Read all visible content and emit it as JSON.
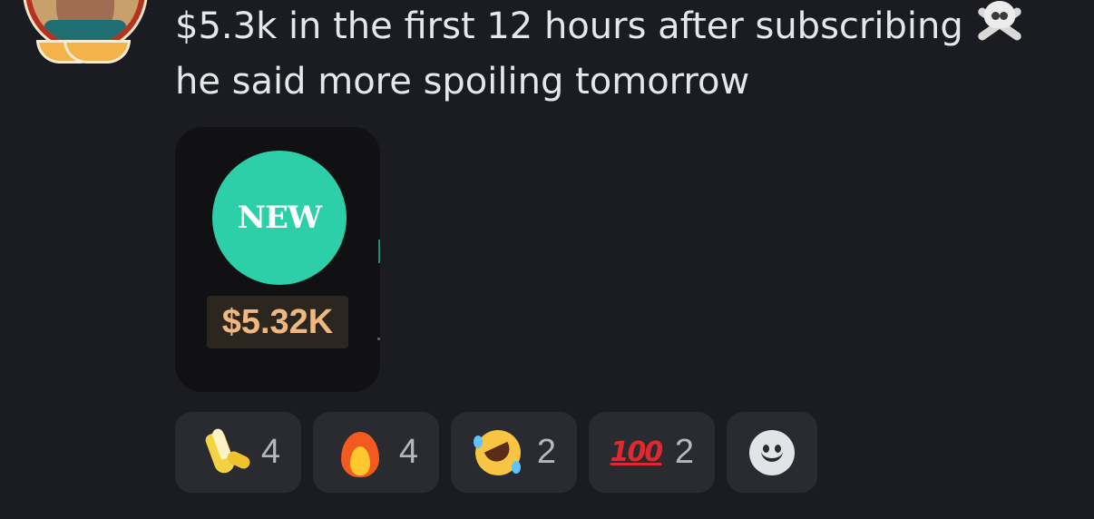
{
  "message": {
    "line1": "$5.3k in the first 12 hours after subscribing",
    "line2": "he said more spoiling tomorrow",
    "line1_emoji_icon": "skull-and-crossbones-icon"
  },
  "attachment": {
    "badge_text": "NEW",
    "price_text": "$5.32K",
    "badge_color": "#2ccfa8",
    "price_color": "#f0b77f"
  },
  "reactions": [
    {
      "icon": "banana-icon",
      "count": "4"
    },
    {
      "icon": "fire-icon",
      "count": "4"
    },
    {
      "icon": "rolling-on-floor-laughing-icon",
      "count": "2"
    },
    {
      "icon": "hundred-points-icon",
      "glyph": "100",
      "count": "2"
    }
  ],
  "add_reaction_icon": "add-reaction-smiley-icon",
  "colors": {
    "background": "#1b1c21",
    "text": "#e6e7ea",
    "reaction_bg": "#2a2b31",
    "reaction_count": "#b5b7bd"
  }
}
